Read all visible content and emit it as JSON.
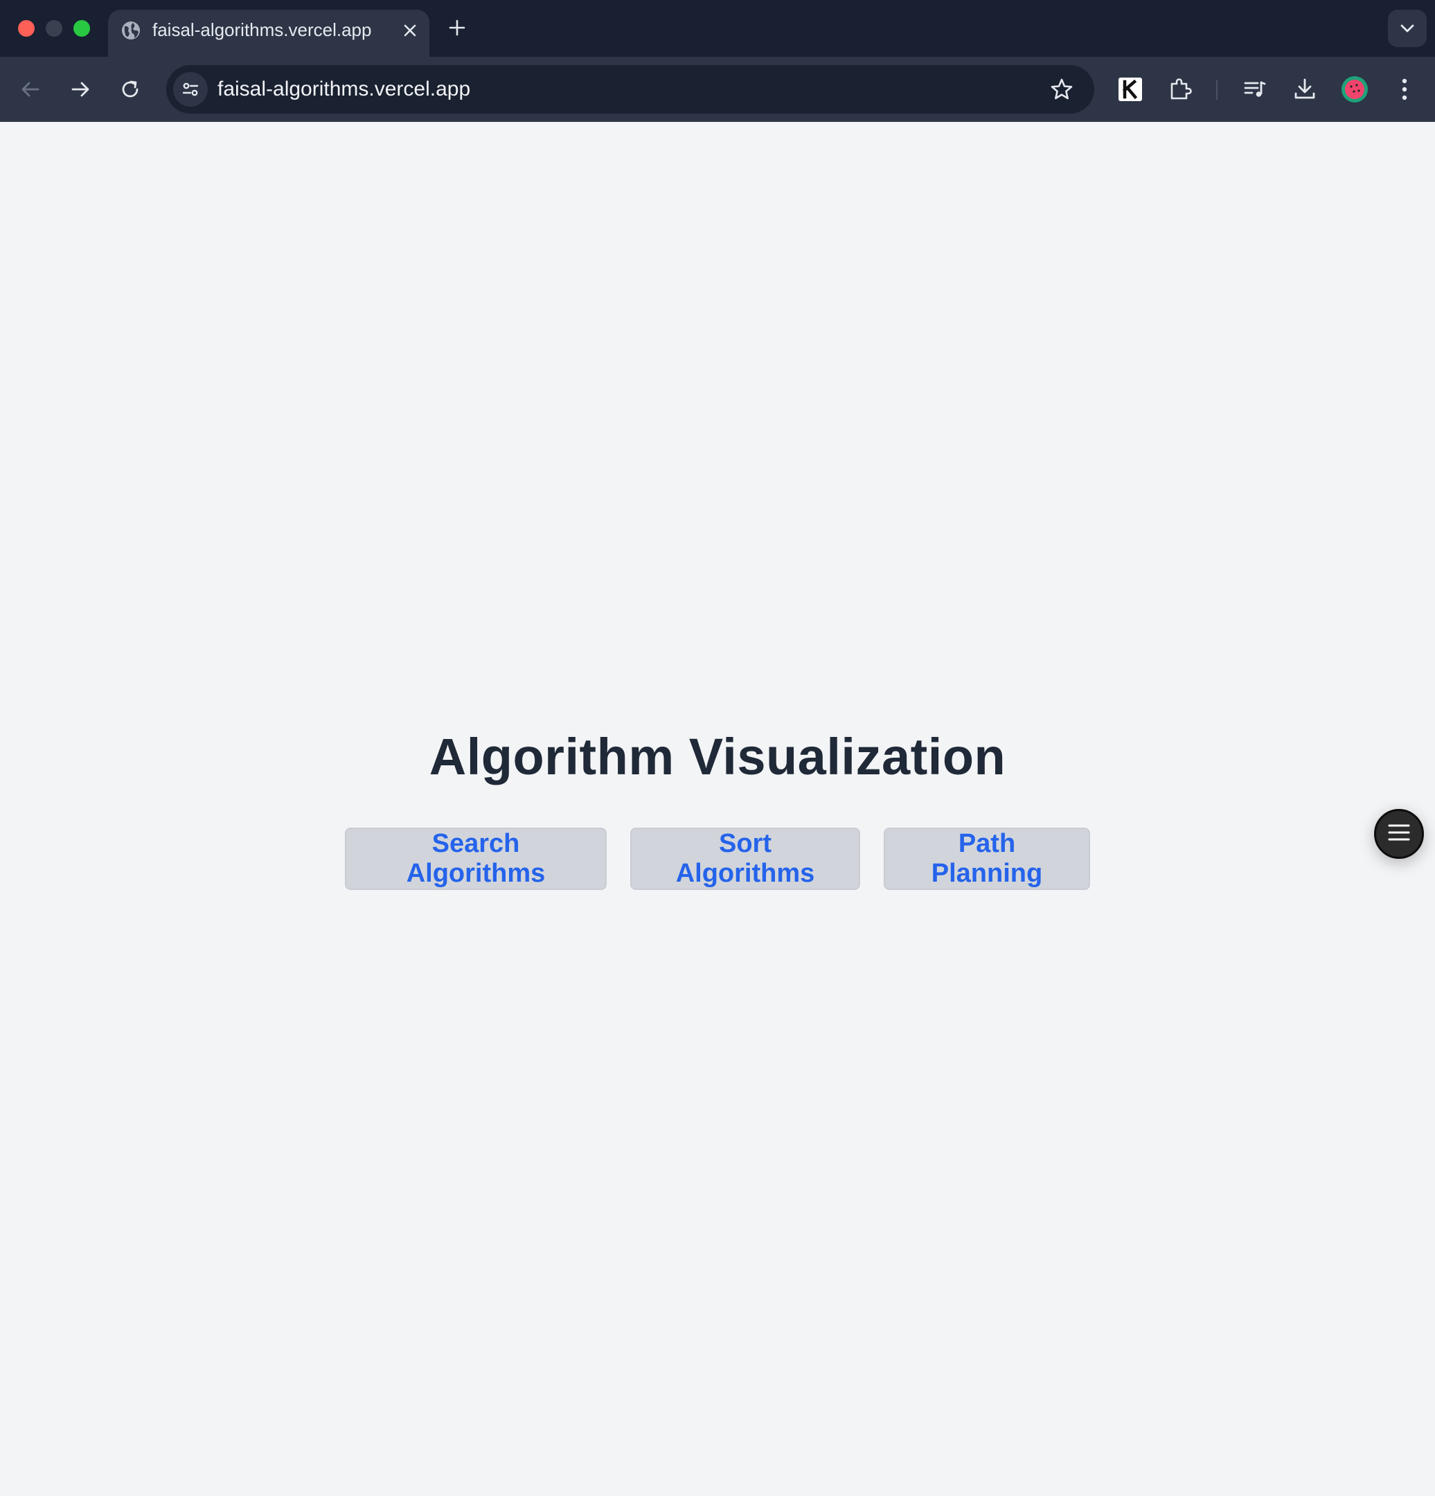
{
  "browser": {
    "tab_title": "faisal-algorithms.vercel.app",
    "url": "faisal-algorithms.vercel.app",
    "icons": [
      "globe-icon",
      "close-icon",
      "plus-icon",
      "chevron-down-icon",
      "back-arrow-icon",
      "forward-arrow-icon",
      "reload-icon",
      "site-settings-icon",
      "star-icon",
      "k-extension-icon",
      "puzzle-icon",
      "media-queue-icon",
      "download-icon",
      "profile-avatar-icon",
      "kebab-menu-icon"
    ]
  },
  "page": {
    "title": "Algorithm Visualization",
    "buttons": [
      {
        "label": "Search Algorithms"
      },
      {
        "label": "Sort Algorithms"
      },
      {
        "label": "Path Planning"
      }
    ],
    "menu_icon": "hamburger-icon"
  },
  "colors": {
    "page_bg": "#f3f4f6",
    "title": "#1f2937",
    "button_bg": "#d1d5db",
    "button_text": "#2563eb",
    "chrome_bg": "#182031"
  }
}
